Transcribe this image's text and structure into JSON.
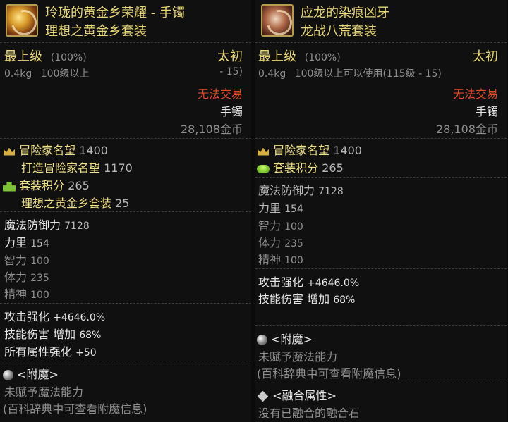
{
  "left": {
    "icon": "golden-bracelet-icon",
    "title": "玲珑的黄金乡荣耀 - 手镯",
    "set_name": "理想之黄金乡套装",
    "grade": "最上级",
    "grade_pct": "(100%)",
    "tier": "太初",
    "weight": "0.4kg",
    "level_req": "100级以上",
    "level_range": "- 15)",
    "trade": "无法交易",
    "slot": "手镯",
    "price": "28,108金币",
    "fame_label": "冒险家名望",
    "fame_value": "1400",
    "forge_fame_label": "打造冒险家名望",
    "forge_fame_value": "1170",
    "set_points_label": "套装积分",
    "set_points_value": "265",
    "set_points_sub_label": "理想之黄金乡套装",
    "set_points_sub_value": "25",
    "mdef_label": "魔法防御力",
    "mdef_value": "7128",
    "str_label": "力里",
    "str_value": "154",
    "int_label": "智力",
    "int_value": "100",
    "vit_label": "体力",
    "vit_value": "235",
    "spi_label": "精神",
    "spi_value": "100",
    "atk_label": "攻击强化",
    "atk_value": "+4646.0%",
    "skill_label": "技能伤害",
    "skill_mid": "增加",
    "skill_value": "68%",
    "allattr_label": "所有属性强化",
    "allattr_value": "+50",
    "enchant_title": "<附魔>",
    "enchant_status": "未赋予魔法能力",
    "enchant_hint": "(百科辞典中可查看附魔信息)"
  },
  "right": {
    "icon": "dragon-fang-icon",
    "title": "应龙的染痕凶牙",
    "set_name": "龙战八荒套装",
    "grade": "最上级",
    "grade_pct": "(100%)",
    "tier": "太初",
    "weight": "0.4kg",
    "level_req": "100级以上可以使用(115级 - 15)",
    "trade": "无法交易",
    "slot": "手镯",
    "price": "28,108金币",
    "fame_label": "冒险家名望",
    "fame_value": "1400",
    "set_points_label": "套装积分",
    "set_points_value": "265",
    "mdef_label": "魔法防御力",
    "mdef_value": "7128",
    "str_label": "力里",
    "str_value": "154",
    "int_label": "智力",
    "int_value": "100",
    "vit_label": "体力",
    "vit_value": "235",
    "spi_label": "精神",
    "spi_value": "100",
    "atk_label": "攻击强化",
    "atk_value": "+4646.0%",
    "skill_label": "技能伤害",
    "skill_mid": "增加",
    "skill_value": "68%",
    "enchant_title": "<附魔>",
    "enchant_status": "未赋予魔法能力",
    "enchant_hint": "(百科辞典中可查看附魔信息)",
    "fusion_title": "<融合属性>",
    "fusion_status": "没有已融合的融合石"
  },
  "colors": {
    "title_gold": "#e8d77a",
    "trade_red": "#e04a2a",
    "stat_white": "#e6e6e6",
    "stat_gray": "#8f8f8f"
  }
}
